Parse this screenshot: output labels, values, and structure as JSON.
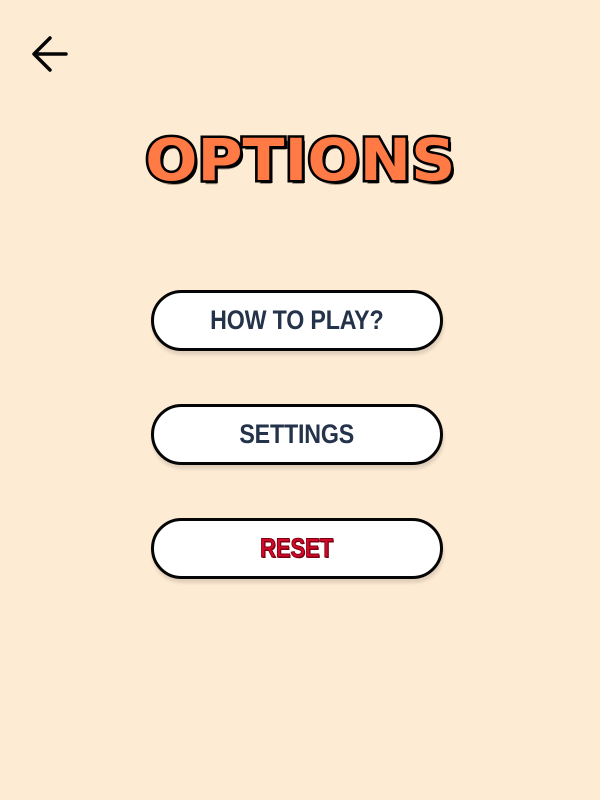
{
  "page": {
    "background_color": "#FEEBD4"
  },
  "header": {
    "back_icon": "back-arrow-icon",
    "title": "OPTIONS",
    "title_color": "#FF7A45",
    "title_stroke_color": "#000000"
  },
  "menu": {
    "buttons": [
      {
        "label": "HOW TO PLAY?",
        "text_color": "#24324A",
        "background_color": "#FFFFFF"
      },
      {
        "label": "SETTINGS",
        "text_color": "#24324A",
        "background_color": "#FFFFFF"
      },
      {
        "label": "RESET",
        "text_color": "#D10A2A",
        "background_color": "#FFFFFF"
      }
    ]
  }
}
